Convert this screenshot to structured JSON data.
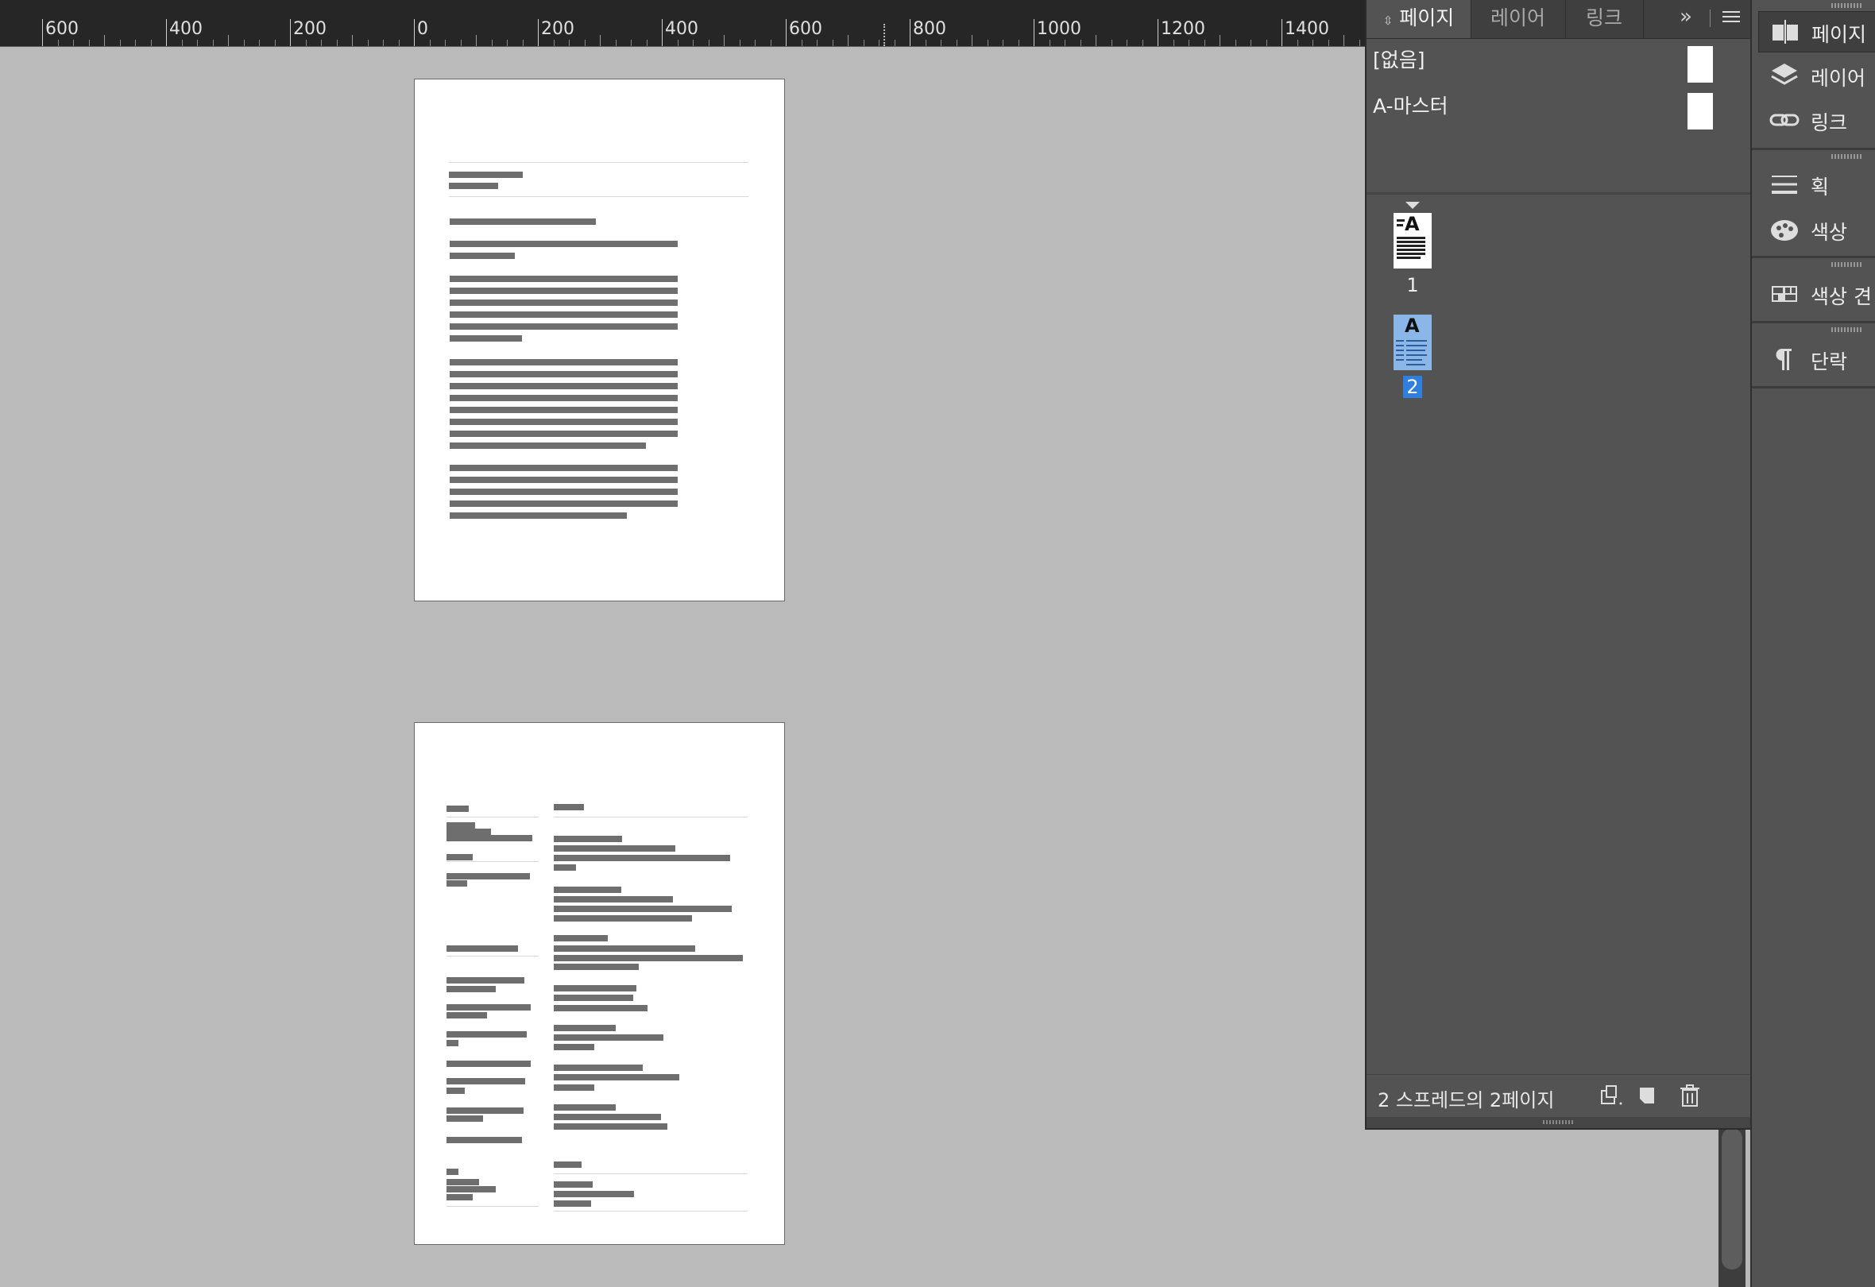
{
  "ruler": {
    "labels": [
      "600",
      "400",
      "200",
      "0",
      "200",
      "400",
      "600",
      "800",
      "1000",
      "1200",
      "1400"
    ]
  },
  "panel": {
    "tabs": [
      {
        "label": "페이지",
        "active": true
      },
      {
        "label": "레이어",
        "active": false
      },
      {
        "label": "링크",
        "active": false
      }
    ],
    "overflow_glyph": "»",
    "masters": [
      {
        "label": "[없음]"
      },
      {
        "label": "A-마스터"
      }
    ],
    "pages": [
      {
        "number": "1",
        "master_prefix": "A",
        "selected": false
      },
      {
        "number": "2",
        "master_prefix": "A",
        "selected": true
      }
    ],
    "status": "2 스프레드의 2페이지",
    "footer_icons": [
      "edit-page-size-icon",
      "new-page-icon",
      "delete-page-icon"
    ]
  },
  "dock": {
    "items": [
      {
        "label": "페이지",
        "icon": "pages-icon",
        "active": true
      },
      {
        "label": "레이어",
        "icon": "layers-icon",
        "active": false
      },
      {
        "label": "링크",
        "icon": "links-icon",
        "active": false
      },
      {
        "label": "획",
        "icon": "stroke-icon",
        "active": false
      },
      {
        "label": "색상",
        "icon": "color-icon",
        "active": false
      },
      {
        "label": "색상 견",
        "icon": "swatches-icon",
        "active": false
      },
      {
        "label": "단락",
        "icon": "paragraph-icon",
        "active": false
      }
    ]
  },
  "colors": {
    "pasteboard": "#bababa",
    "panel": "#535353",
    "selection": "#2f7fe0"
  }
}
